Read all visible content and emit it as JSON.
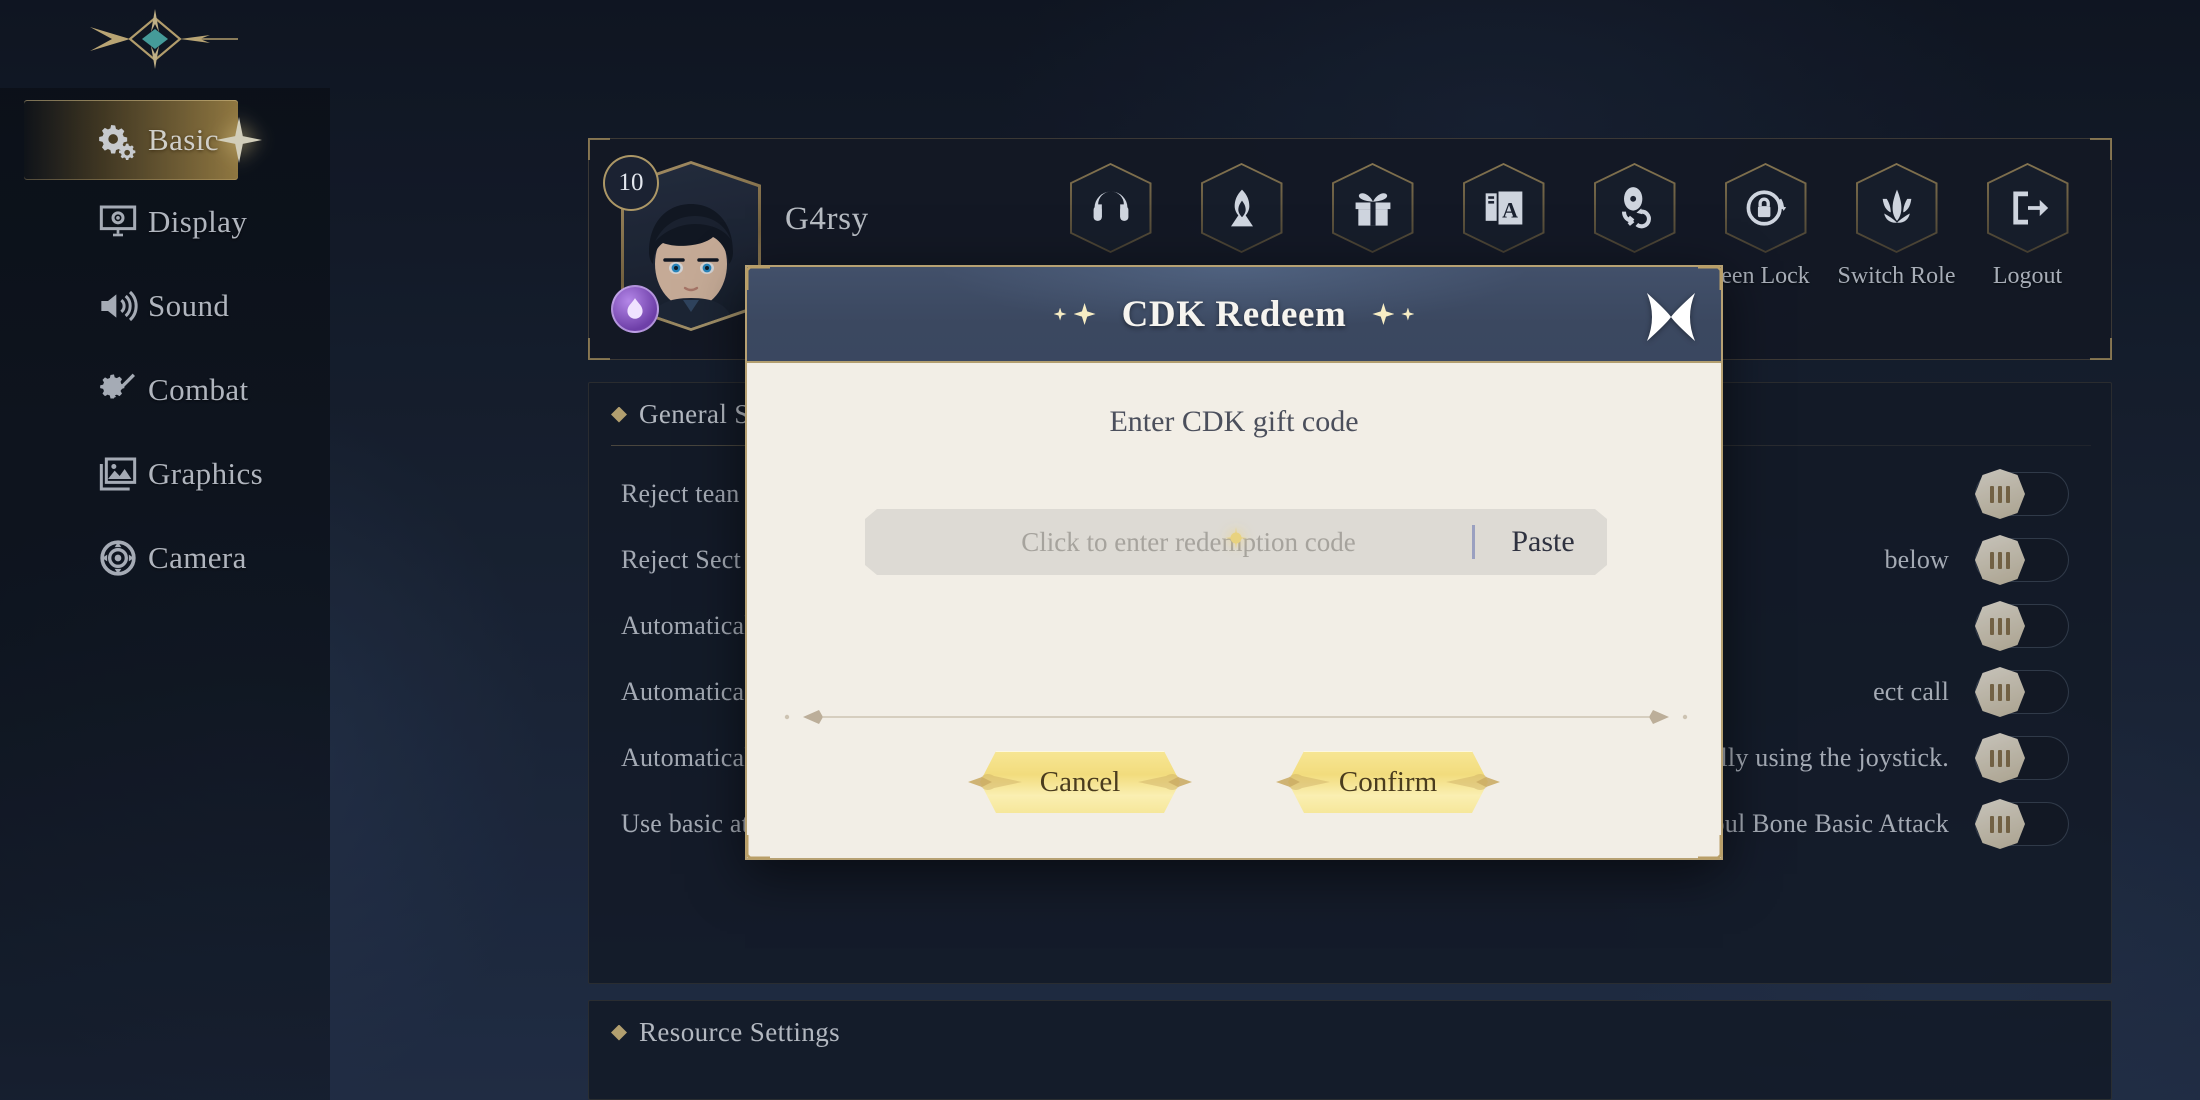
{
  "app": {
    "logo_icon": "star-crest-logo"
  },
  "sidebar": {
    "items": [
      {
        "label": "Basic",
        "icon": "gears-icon",
        "active": true
      },
      {
        "label": "Display",
        "icon": "monitor-icon",
        "active": false
      },
      {
        "label": "Sound",
        "icon": "speaker-icon",
        "active": false
      },
      {
        "label": "Combat",
        "icon": "sword-gear-icon",
        "active": false
      },
      {
        "label": "Graphics",
        "icon": "image-icon",
        "active": false
      },
      {
        "label": "Camera",
        "icon": "camera-icon",
        "active": false
      }
    ]
  },
  "profile": {
    "level": "10",
    "name": "G4rsy",
    "avatar_icon": "character-portrait",
    "element_icon": "dark-element-icon",
    "actions": [
      {
        "label": "",
        "icon": "headset-icon"
      },
      {
        "label": "",
        "icon": "hood-figure-icon"
      },
      {
        "label": "",
        "icon": "gift-icon"
      },
      {
        "label": "",
        "icon": "language-icon"
      },
      {
        "label": "",
        "icon": "voice-switch-icon"
      },
      {
        "label": "een Lock",
        "icon": "screen-lock-icon"
      },
      {
        "label": "Switch Role",
        "icon": "role-crest-icon"
      },
      {
        "label": "Logout",
        "icon": "logout-icon"
      }
    ]
  },
  "settings": {
    "section_title": "General Se",
    "section_title_2": "Resource Settings",
    "rows": [
      {
        "left": "Reject tean",
        "right": "",
        "left_toggle": false,
        "right_toggle": true
      },
      {
        "left": "Reject Sect",
        "right": "below",
        "left_toggle": false,
        "right_toggle": true
      },
      {
        "left": "Automatical",
        "right": "",
        "left_toggle": false,
        "right_toggle": true
      },
      {
        "left": "Automatica",
        "right": "ect call",
        "left_toggle": false,
        "right_toggle": true
      },
      {
        "left": "Automatically agree to enter instances",
        "right": "Mount automatically using the joystick.",
        "left_toggle": false,
        "right_toggle": true
      },
      {
        "left": "Use basic attack to select target",
        "right": "Priority for External Soul Bone Basic Attack",
        "left_toggle": false,
        "right_toggle": true
      }
    ]
  },
  "modal": {
    "title": "CDK Redeem",
    "close_icon": "close-star-icon",
    "prompt": "Enter CDK gift code",
    "input_placeholder": "Click to enter redemption code",
    "input_value": "",
    "paste_label": "Paste",
    "cancel_label": "Cancel",
    "confirm_label": "Confirm"
  },
  "colors": {
    "gold": "#c6a86e",
    "modal_header": "#3b4860",
    "modal_body": "#f2eee6",
    "button_gold": "#f2dc7d",
    "sidebar_active": "#c4a052",
    "background": "#1c2638"
  }
}
